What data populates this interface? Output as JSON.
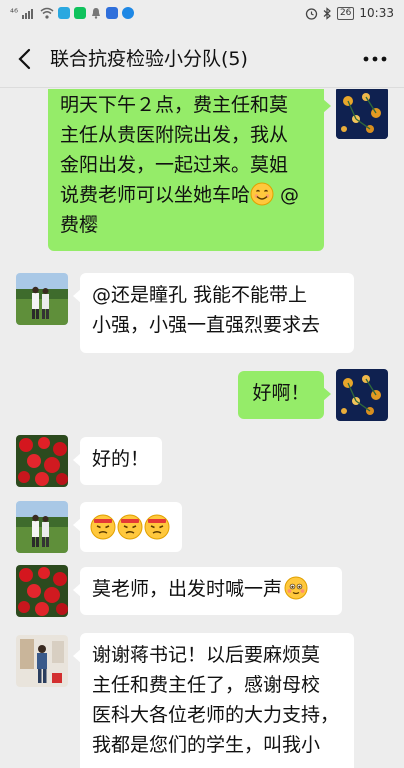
{
  "status_bar": {
    "carrier_signal": "⁴⁶",
    "time": "10:33",
    "battery": "26",
    "app_colors": [
      "#2aa8e0",
      "#0fc25c",
      "#2f6fdb",
      "#1e88e5"
    ]
  },
  "header": {
    "title": "联合抗疫检验小分队(5)"
  },
  "messages": [
    {
      "direction": "out",
      "lines": [
        "明天下午２点，费主任和莫",
        "主任从贵医附院出发，我从",
        "金阳出发，一起过来。莫姐",
        "说费老师可以坐她车哈",
        "费樱"
      ],
      "emoji_line4": "smiling-face-emoji",
      "mention_suffix": " @"
    },
    {
      "direction": "in",
      "lines": [
        "@还是瞳孔  我能不能带上",
        "小强，小强一直强烈要求去"
      ]
    },
    {
      "direction": "out",
      "text": "好啊！"
    },
    {
      "direction": "in",
      "text": "好的！"
    },
    {
      "direction": "in",
      "emojis": [
        "determined-face-emoji",
        "determined-face-emoji",
        "determined-face-emoji"
      ]
    },
    {
      "direction": "in",
      "text": "莫老师，出发时喊一声",
      "emoji": "blushing-face-emoji"
    },
    {
      "direction": "in",
      "lines": [
        "谢谢蒋书记！以后要麻烦莫",
        "主任和费主任了，感谢母校",
        "医科大各位老师的大力支持，",
        "我都是您们的学生，叫我小"
      ]
    }
  ],
  "colors": {
    "background": "#ededed",
    "incoming_bubble": "#ffffff",
    "outgoing_bubble": "#95ec69"
  }
}
